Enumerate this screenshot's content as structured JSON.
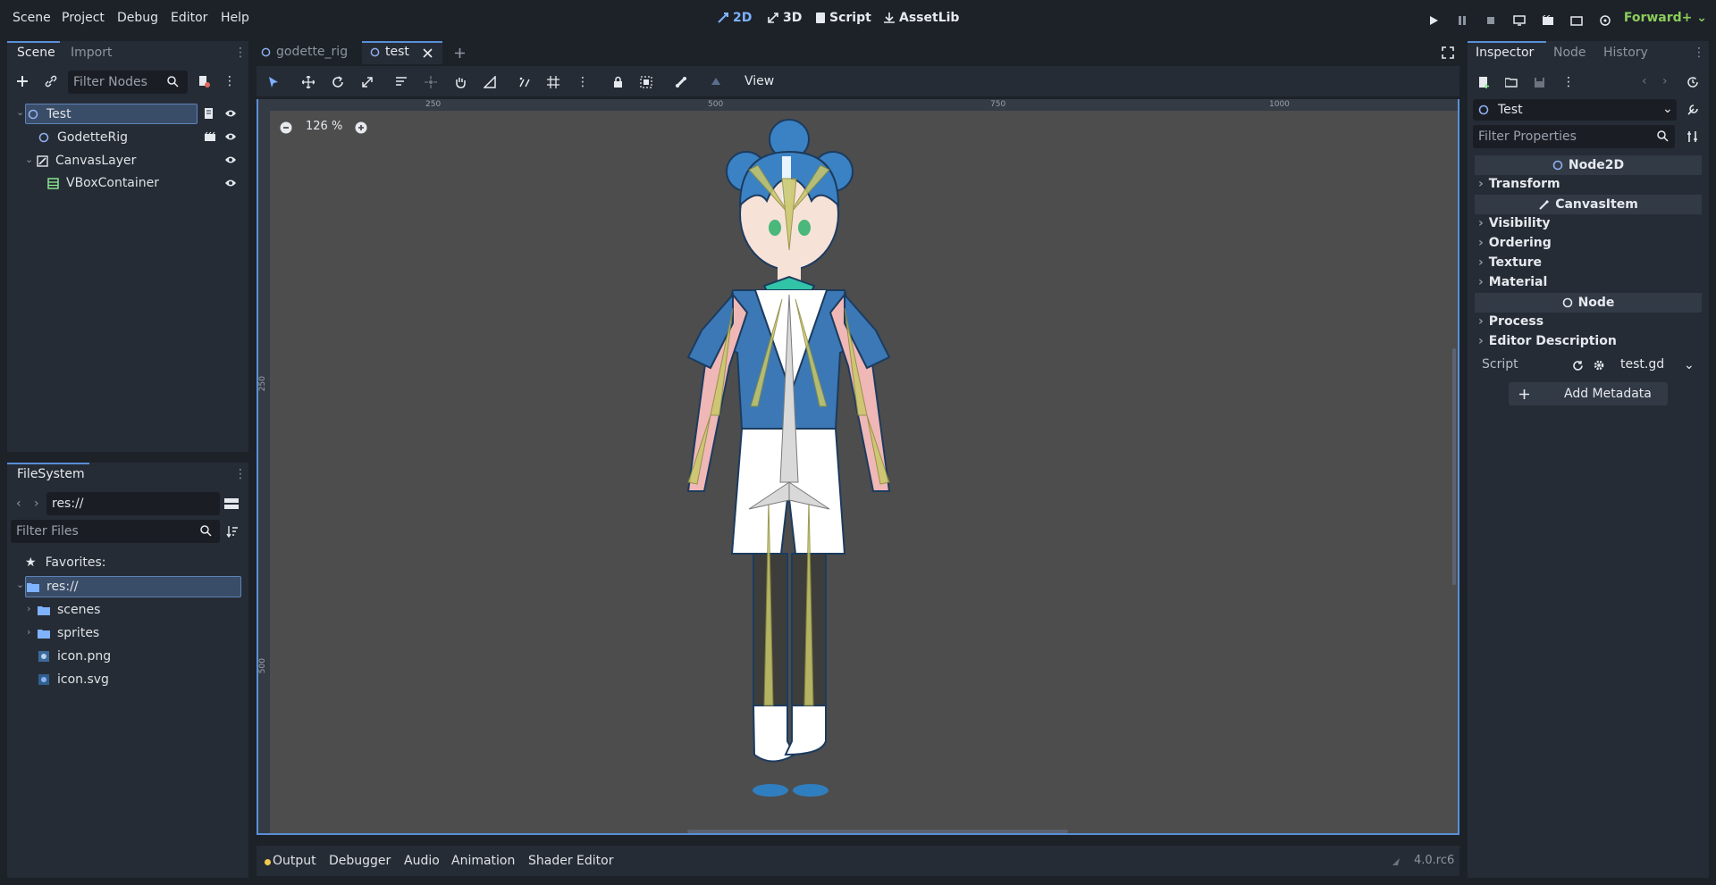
{
  "menu": {
    "scene": "Scene",
    "project": "Project",
    "debug": "Debug",
    "editor": "Editor",
    "help": "Help"
  },
  "workspaces": {
    "two_d": "2D",
    "three_d": "3D",
    "script": "Script",
    "assetlib": "AssetLib"
  },
  "renderer": "Forward+",
  "scene_dock": {
    "tabs": [
      "Scene",
      "Import"
    ],
    "filter_placeholder": "Filter Nodes",
    "nodes": [
      {
        "name": "Test"
      },
      {
        "name": "GodetteRig"
      },
      {
        "name": "CanvasLayer"
      },
      {
        "name": "VBoxContainer"
      }
    ]
  },
  "filesystem_dock": {
    "title": "FileSystem",
    "path": "res://",
    "filter_placeholder": "Filter Files",
    "favorites": "Favorites:",
    "items": [
      "res://",
      "scenes",
      "sprites",
      "icon.png",
      "icon.svg"
    ]
  },
  "editor_tabs": [
    "godette_rig",
    "test"
  ],
  "viewport_toolbar": {
    "view": "View"
  },
  "zoom": "126 %",
  "rulers": {
    "h": [
      "250",
      "500",
      "750",
      "1000"
    ],
    "v": [
      "250",
      "500"
    ]
  },
  "inspector": {
    "tabs": [
      "Inspector",
      "Node",
      "History"
    ],
    "object": "Test",
    "filter_placeholder": "Filter Properties",
    "sections": {
      "node2d": "Node2D",
      "transform": "Transform",
      "canvasitem": "CanvasItem",
      "visibility": "Visibility",
      "ordering": "Ordering",
      "texture": "Texture",
      "material": "Material",
      "node": "Node",
      "process": "Process",
      "editor_description": "Editor Description"
    },
    "script_label": "Script",
    "script_value": "test.gd",
    "add_metadata": "Add Metadata"
  },
  "bottom_tabs": [
    "Output",
    "Debugger",
    "Audio",
    "Animation",
    "Shader Editor"
  ],
  "version": "4.0.rc6",
  "colors": {
    "accent": "#5a8fd8",
    "renderer": "#8ccd5a",
    "viewport_bg": "#4d4d4d"
  }
}
